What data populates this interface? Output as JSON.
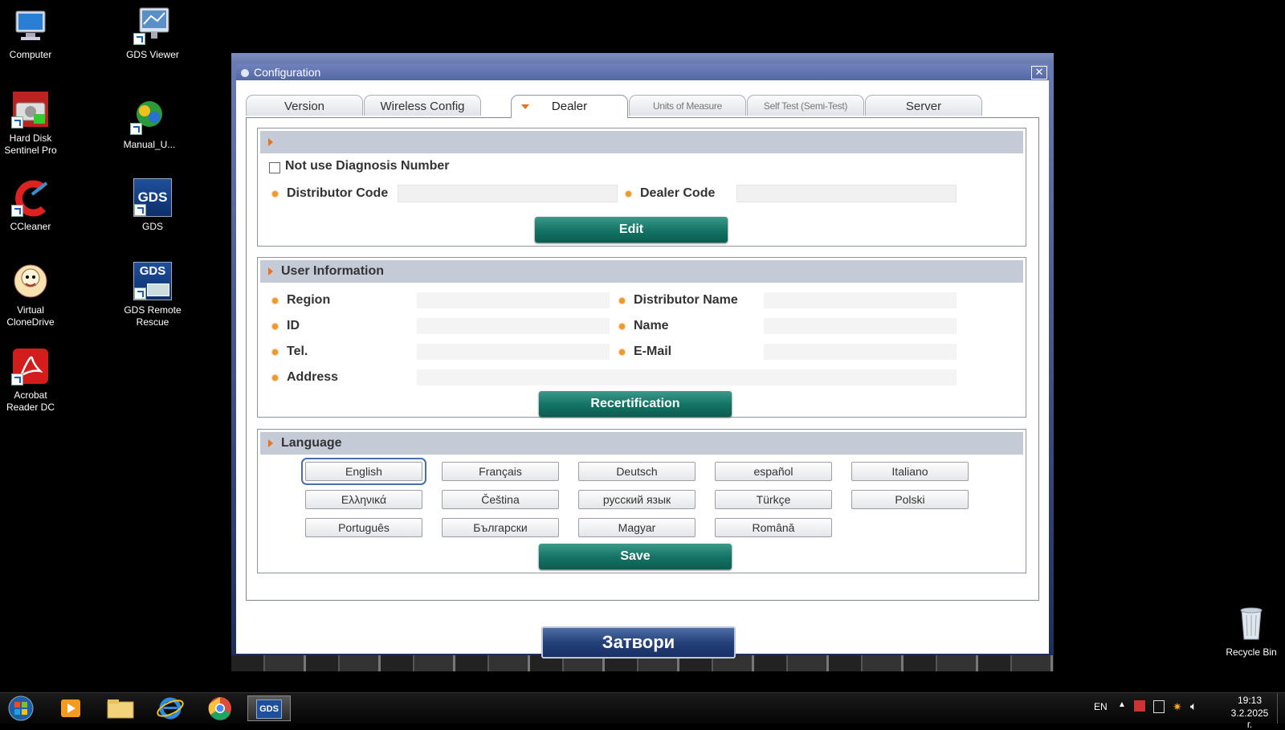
{
  "desktop": {
    "icons": [
      {
        "label": "Computer",
        "icon": "computer-icon"
      },
      {
        "label": "GDS Viewer",
        "icon": "gds-viewer-icon"
      },
      {
        "label": "Hard Disk Sentinel Pro",
        "icon": "hard-disk-sentinel-icon"
      },
      {
        "label": "Manual_U...",
        "icon": "manual-icon"
      },
      {
        "label": "CCleaner",
        "icon": "ccleaner-icon"
      },
      {
        "label": "GDS",
        "icon": "gds-icon"
      },
      {
        "label": "Virtual CloneDrive",
        "icon": "virtual-clonedrive-icon"
      },
      {
        "label": "GDS Remote Rescue",
        "icon": "gds-remote-rescue-icon"
      },
      {
        "label": "Acrobat Reader DC",
        "icon": "acrobat-icon"
      },
      {
        "label": "Recycle Bin",
        "icon": "recycle-bin-icon"
      }
    ],
    "gds_icon_text": "GDS"
  },
  "window": {
    "title": "Configuration",
    "close_glyph": "✕",
    "tabs": [
      {
        "label": "Version"
      },
      {
        "label": "Wireless Config"
      },
      {
        "label": "Dealer"
      },
      {
        "label": "Units of Measure"
      },
      {
        "label": "Self Test (Semi-Test)"
      },
      {
        "label": "Server"
      }
    ],
    "active_tab": "Dealer",
    "dealer_section": {
      "checkbox_label": "Not use Diagnosis Number",
      "checked": false,
      "distributor_code_label": "Distributor Code",
      "distributor_code_value": "",
      "dealer_code_label": "Dealer Code",
      "dealer_code_value": "",
      "edit_button": "Edit"
    },
    "user_information": {
      "title": "User Information",
      "region_label": "Region",
      "distributor_name_label": "Distributor Name",
      "id_label": "ID",
      "name_label": "Name",
      "tel_label": "Tel.",
      "email_label": "E-Mail",
      "address_label": "Address",
      "recertification_button": "Recertification"
    },
    "language": {
      "title": "Language",
      "options": [
        "English",
        "Français",
        "Deutsch",
        "español",
        "Italiano",
        "Ελληνικά",
        "Čeština",
        "русский язык",
        "Türkçe",
        "Polski",
        "Português",
        "Български",
        "Magyar",
        "Română"
      ],
      "selected": "English",
      "save_button": "Save"
    },
    "close_button": "Затвори"
  },
  "taskbar": {
    "tray": {
      "lang": "EN",
      "time": "19:13",
      "date": "3.2.2025 г."
    },
    "gds_label": "GDS"
  },
  "colors": {
    "accent_green": "#157566",
    "accent_blue": "#25417a",
    "bullet_orange": "#f09a2a",
    "section_header": "#c5cad7"
  }
}
